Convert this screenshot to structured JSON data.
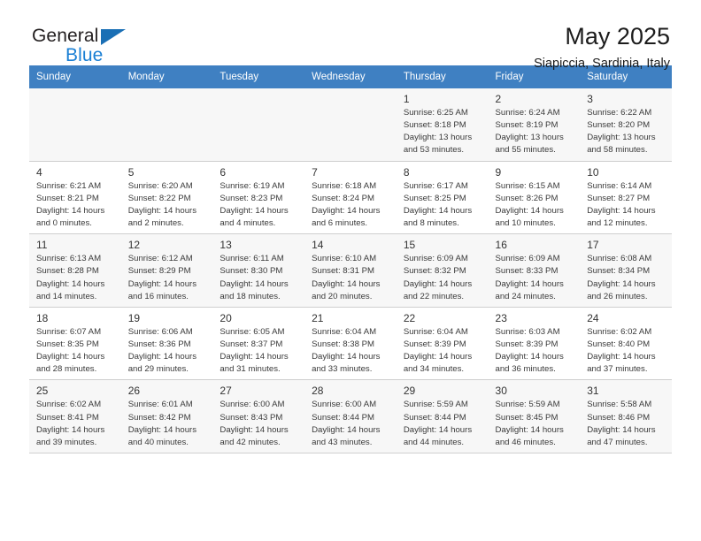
{
  "brand": {
    "name_top": "General",
    "name_bottom": "Blue",
    "flag_icon": "triangle-flag-icon",
    "accent_color": "#1a7fd4"
  },
  "header": {
    "title": "May 2025",
    "subtitle": "Siapiccia, Sardinia, Italy"
  },
  "calendar": {
    "header_bg": "#3f80c2",
    "weekday_headers": [
      "Sunday",
      "Monday",
      "Tuesday",
      "Wednesday",
      "Thursday",
      "Friday",
      "Saturday"
    ],
    "weeks": [
      [
        {
          "day": "",
          "detail": ""
        },
        {
          "day": "",
          "detail": ""
        },
        {
          "day": "",
          "detail": ""
        },
        {
          "day": "",
          "detail": ""
        },
        {
          "day": "1",
          "detail": "Sunrise: 6:25 AM\nSunset: 8:18 PM\nDaylight: 13 hours\nand 53 minutes."
        },
        {
          "day": "2",
          "detail": "Sunrise: 6:24 AM\nSunset: 8:19 PM\nDaylight: 13 hours\nand 55 minutes."
        },
        {
          "day": "3",
          "detail": "Sunrise: 6:22 AM\nSunset: 8:20 PM\nDaylight: 13 hours\nand 58 minutes."
        }
      ],
      [
        {
          "day": "4",
          "detail": "Sunrise: 6:21 AM\nSunset: 8:21 PM\nDaylight: 14 hours\nand 0 minutes."
        },
        {
          "day": "5",
          "detail": "Sunrise: 6:20 AM\nSunset: 8:22 PM\nDaylight: 14 hours\nand 2 minutes."
        },
        {
          "day": "6",
          "detail": "Sunrise: 6:19 AM\nSunset: 8:23 PM\nDaylight: 14 hours\nand 4 minutes."
        },
        {
          "day": "7",
          "detail": "Sunrise: 6:18 AM\nSunset: 8:24 PM\nDaylight: 14 hours\nand 6 minutes."
        },
        {
          "day": "8",
          "detail": "Sunrise: 6:17 AM\nSunset: 8:25 PM\nDaylight: 14 hours\nand 8 minutes."
        },
        {
          "day": "9",
          "detail": "Sunrise: 6:15 AM\nSunset: 8:26 PM\nDaylight: 14 hours\nand 10 minutes."
        },
        {
          "day": "10",
          "detail": "Sunrise: 6:14 AM\nSunset: 8:27 PM\nDaylight: 14 hours\nand 12 minutes."
        }
      ],
      [
        {
          "day": "11",
          "detail": "Sunrise: 6:13 AM\nSunset: 8:28 PM\nDaylight: 14 hours\nand 14 minutes."
        },
        {
          "day": "12",
          "detail": "Sunrise: 6:12 AM\nSunset: 8:29 PM\nDaylight: 14 hours\nand 16 minutes."
        },
        {
          "day": "13",
          "detail": "Sunrise: 6:11 AM\nSunset: 8:30 PM\nDaylight: 14 hours\nand 18 minutes."
        },
        {
          "day": "14",
          "detail": "Sunrise: 6:10 AM\nSunset: 8:31 PM\nDaylight: 14 hours\nand 20 minutes."
        },
        {
          "day": "15",
          "detail": "Sunrise: 6:09 AM\nSunset: 8:32 PM\nDaylight: 14 hours\nand 22 minutes."
        },
        {
          "day": "16",
          "detail": "Sunrise: 6:09 AM\nSunset: 8:33 PM\nDaylight: 14 hours\nand 24 minutes."
        },
        {
          "day": "17",
          "detail": "Sunrise: 6:08 AM\nSunset: 8:34 PM\nDaylight: 14 hours\nand 26 minutes."
        }
      ],
      [
        {
          "day": "18",
          "detail": "Sunrise: 6:07 AM\nSunset: 8:35 PM\nDaylight: 14 hours\nand 28 minutes."
        },
        {
          "day": "19",
          "detail": "Sunrise: 6:06 AM\nSunset: 8:36 PM\nDaylight: 14 hours\nand 29 minutes."
        },
        {
          "day": "20",
          "detail": "Sunrise: 6:05 AM\nSunset: 8:37 PM\nDaylight: 14 hours\nand 31 minutes."
        },
        {
          "day": "21",
          "detail": "Sunrise: 6:04 AM\nSunset: 8:38 PM\nDaylight: 14 hours\nand 33 minutes."
        },
        {
          "day": "22",
          "detail": "Sunrise: 6:04 AM\nSunset: 8:39 PM\nDaylight: 14 hours\nand 34 minutes."
        },
        {
          "day": "23",
          "detail": "Sunrise: 6:03 AM\nSunset: 8:39 PM\nDaylight: 14 hours\nand 36 minutes."
        },
        {
          "day": "24",
          "detail": "Sunrise: 6:02 AM\nSunset: 8:40 PM\nDaylight: 14 hours\nand 37 minutes."
        }
      ],
      [
        {
          "day": "25",
          "detail": "Sunrise: 6:02 AM\nSunset: 8:41 PM\nDaylight: 14 hours\nand 39 minutes."
        },
        {
          "day": "26",
          "detail": "Sunrise: 6:01 AM\nSunset: 8:42 PM\nDaylight: 14 hours\nand 40 minutes."
        },
        {
          "day": "27",
          "detail": "Sunrise: 6:00 AM\nSunset: 8:43 PM\nDaylight: 14 hours\nand 42 minutes."
        },
        {
          "day": "28",
          "detail": "Sunrise: 6:00 AM\nSunset: 8:44 PM\nDaylight: 14 hours\nand 43 minutes."
        },
        {
          "day": "29",
          "detail": "Sunrise: 5:59 AM\nSunset: 8:44 PM\nDaylight: 14 hours\nand 44 minutes."
        },
        {
          "day": "30",
          "detail": "Sunrise: 5:59 AM\nSunset: 8:45 PM\nDaylight: 14 hours\nand 46 minutes."
        },
        {
          "day": "31",
          "detail": "Sunrise: 5:58 AM\nSunset: 8:46 PM\nDaylight: 14 hours\nand 47 minutes."
        }
      ]
    ]
  }
}
